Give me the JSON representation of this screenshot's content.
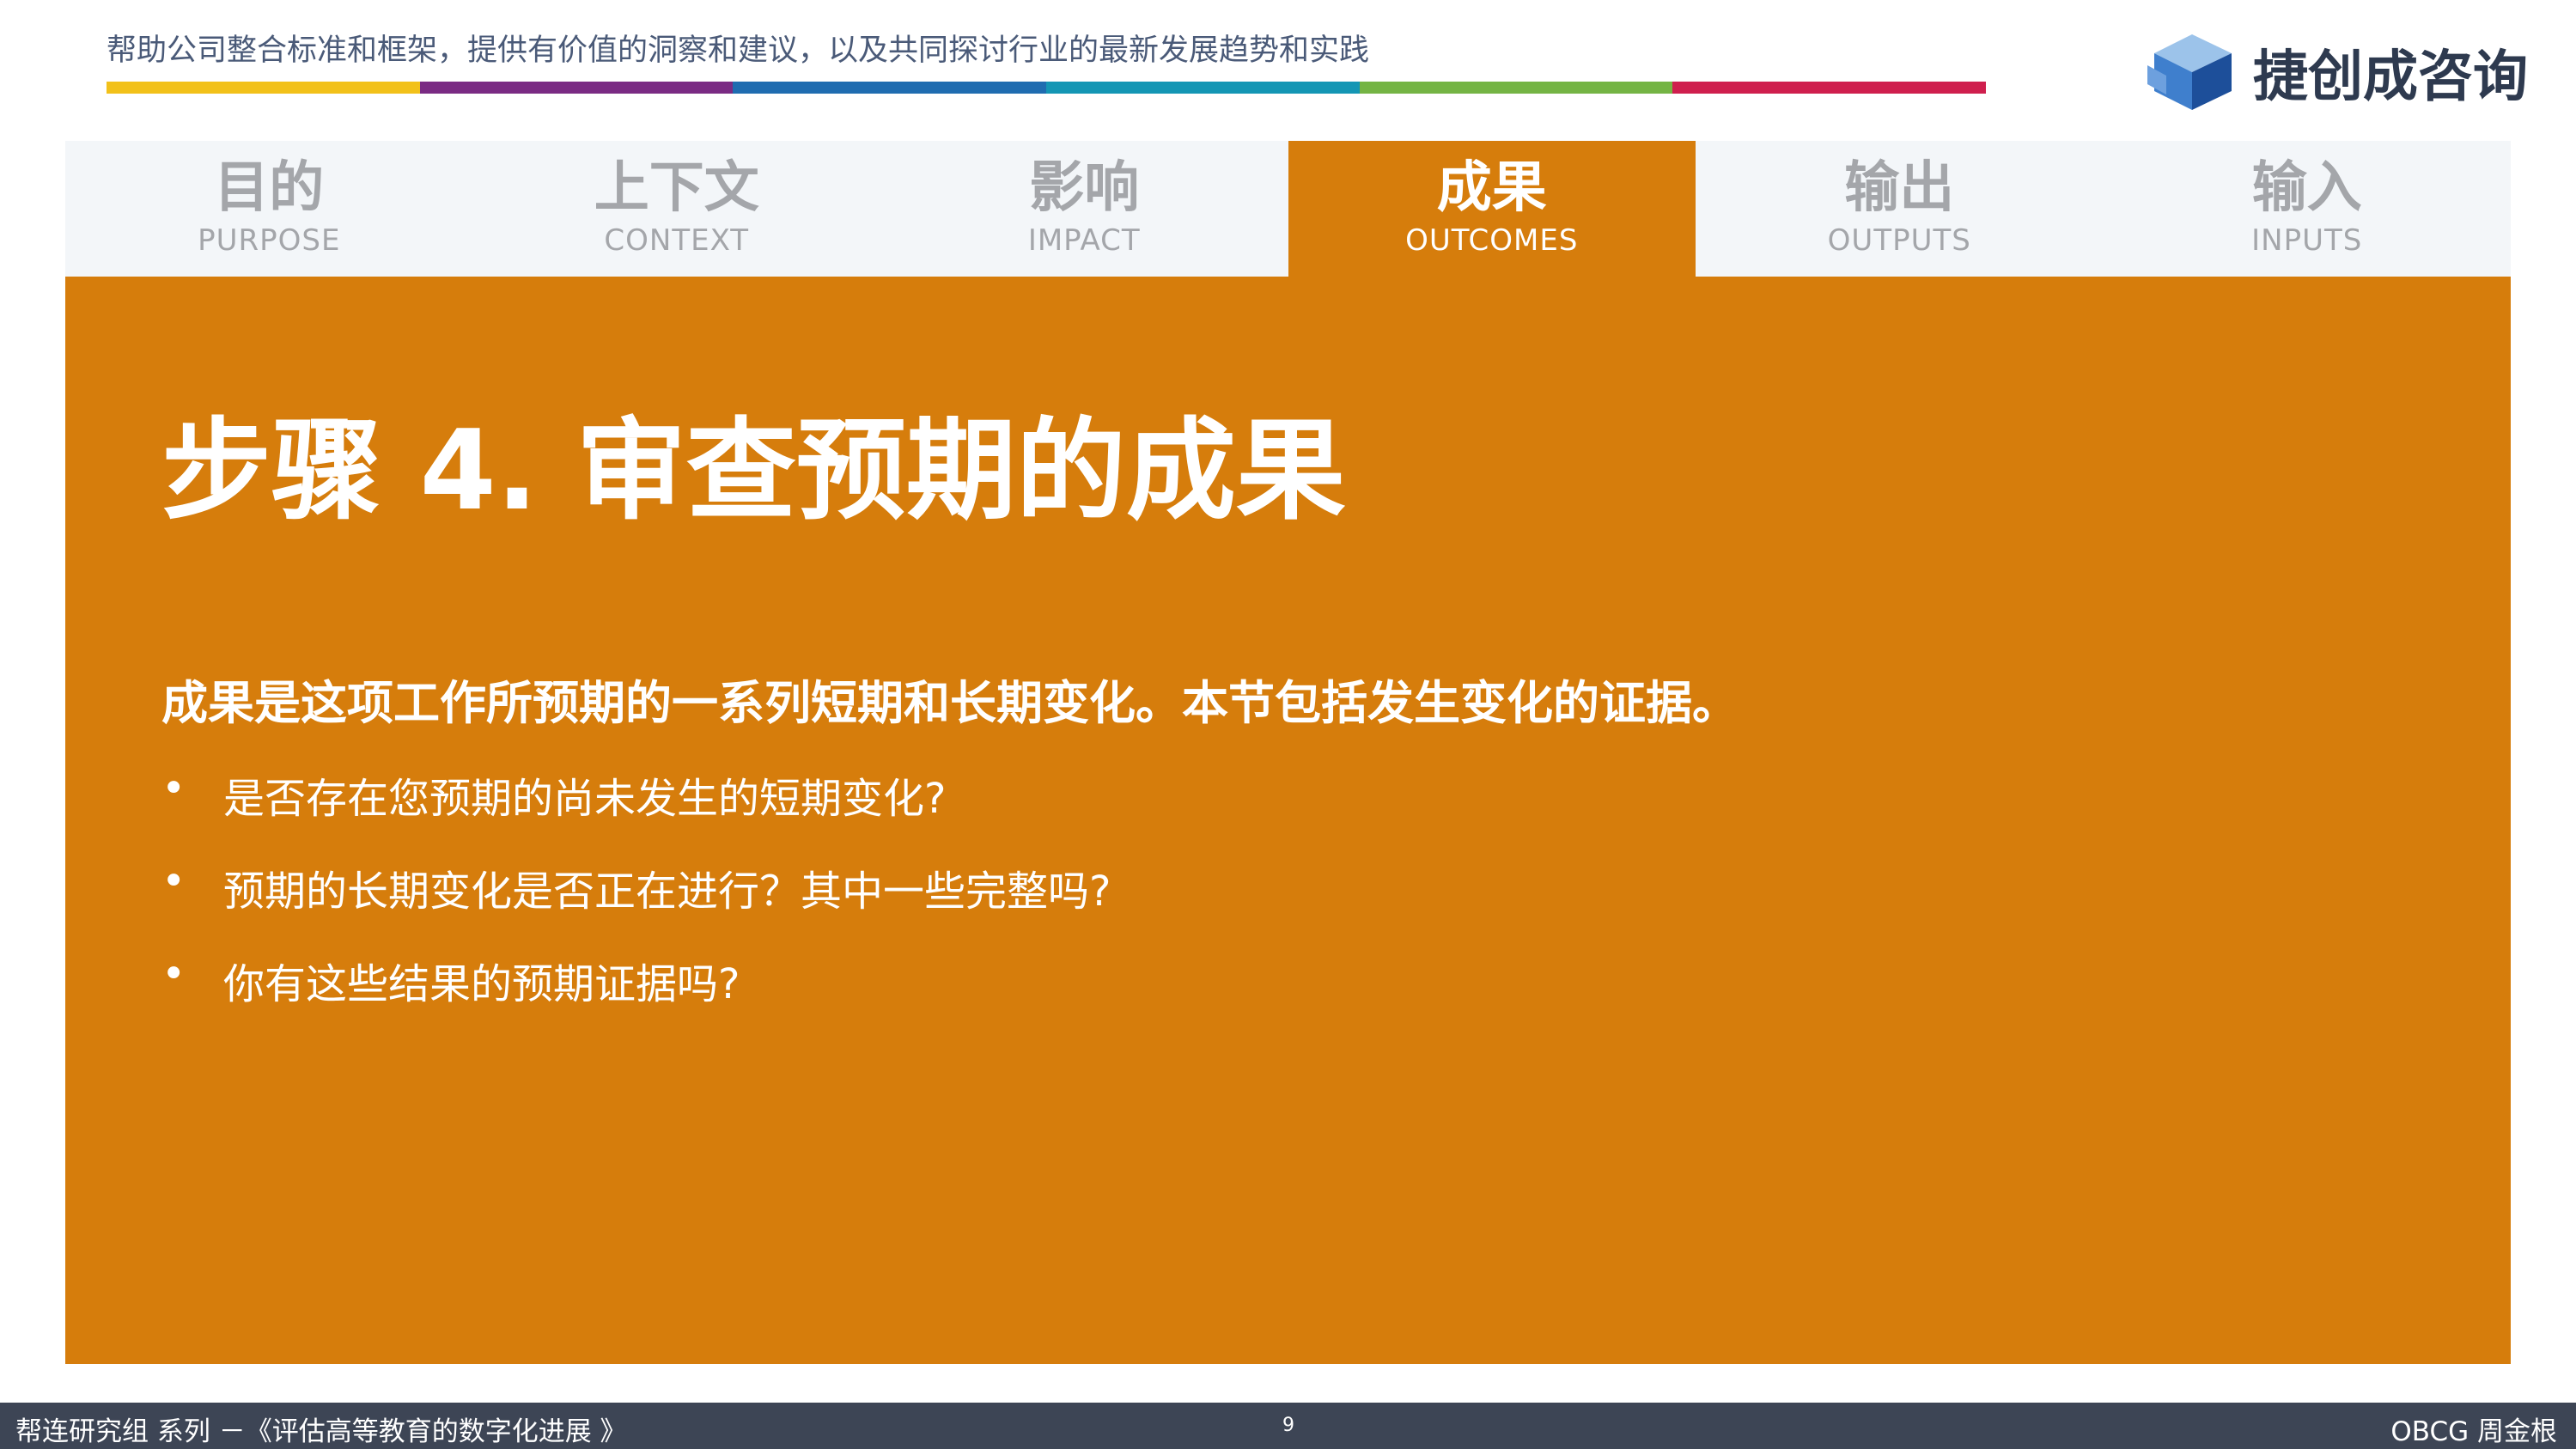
{
  "header": {
    "tagline": "帮助公司整合标准和框架，提供有价值的洞察和建议，以及共同探讨行业的最新发展趋势和实践",
    "color_bar": [
      "#f2c11a",
      "#7a2b83",
      "#1f6cb0",
      "#1496b4",
      "#74b444",
      "#cf1f4e"
    ],
    "logo_text": "捷创成咨询",
    "logo_icon": "blue-cube-icon"
  },
  "tabs": [
    {
      "cn": "目的",
      "en": "PURPOSE",
      "active": false
    },
    {
      "cn": "上下文",
      "en": "CONTEXT",
      "active": false
    },
    {
      "cn": "影响",
      "en": "IMPACT",
      "active": false
    },
    {
      "cn": "成果",
      "en": "OUTCOMES",
      "active": true
    },
    {
      "cn": "输出",
      "en": "OUTPUTS",
      "active": false
    },
    {
      "cn": "输入",
      "en": "INPUTS",
      "active": false
    }
  ],
  "content": {
    "heading": "步骤 4. 审查预期的成果",
    "intro": "成果是这项工作所预期的一系列短期和长期变化。本节包括发生变化的证据。",
    "bullets": [
      "是否存在您预期的尚未发生的短期变化?",
      "预期的长期变化是否正在进行？其中一些完整吗?",
      "你有这些结果的预期证据吗?"
    ]
  },
  "colors": {
    "accent": "#d67d0c",
    "tab_bg": "#f3f6f9",
    "footer_bg": "#3d4555"
  },
  "footer": {
    "left": "帮连研究组 系列 －《评估高等教育的数字化进展 》",
    "page": "9",
    "right": "OBCG 周金根"
  }
}
